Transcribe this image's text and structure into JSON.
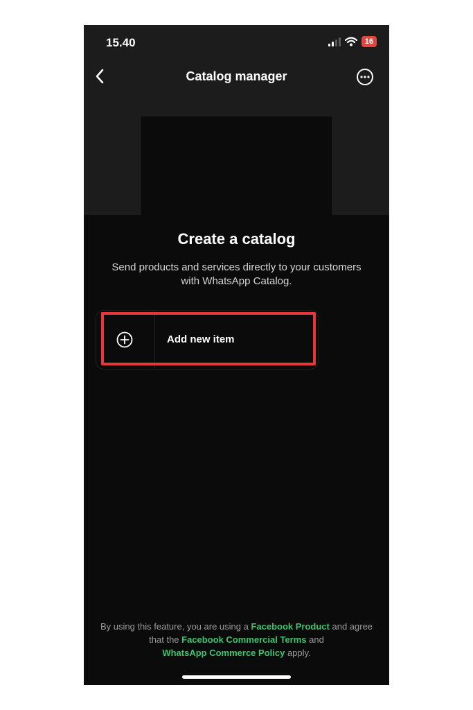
{
  "status_bar": {
    "time": "15.40",
    "battery": "16",
    "icons": [
      "signal-icon",
      "wifi-icon",
      "battery-icon"
    ]
  },
  "nav": {
    "title": "Catalog manager",
    "back_icon": "chevron-left-icon",
    "more_icon": "more-options-icon"
  },
  "main": {
    "headline": "Create a catalog",
    "subtitle_line1": "Send products and services directly to your customers",
    "subtitle_line2": "with WhatsApp Catalog."
  },
  "add_item": {
    "label": "Add new item",
    "icon": "plus-circle-icon"
  },
  "footer": {
    "t1": "By using this feature, you are using a ",
    "link1": "Facebook Product",
    "t2": " and agree",
    "t3": "that the ",
    "link2": "Facebook Commercial Terms",
    "t4": " and",
    "link3": "WhatsApp Commerce Policy",
    "t5": " apply."
  },
  "colors": {
    "background": "#0b0b0b",
    "header": "#1c1c1c",
    "link": "#3ec371",
    "highlight": "#e8363b",
    "battery": "#e0463f"
  }
}
